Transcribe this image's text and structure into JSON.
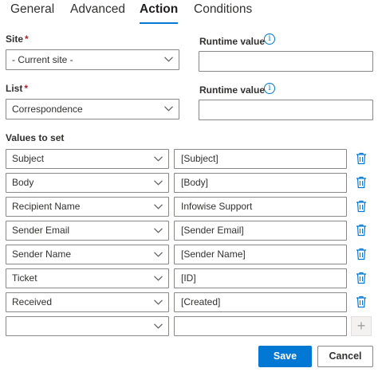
{
  "tabs": [
    {
      "label": "General"
    },
    {
      "label": "Advanced"
    },
    {
      "label": "Action"
    },
    {
      "label": "Conditions"
    }
  ],
  "active_tab": "Action",
  "site": {
    "label": "Site",
    "required_mark": "*",
    "value": "- Current site -"
  },
  "site_runtime": {
    "label": "Runtime value",
    "value": ""
  },
  "list": {
    "label": "List",
    "required_mark": "*",
    "value": "Correspondence"
  },
  "list_runtime": {
    "label": "Runtime value",
    "value": ""
  },
  "values_to_set": {
    "label": "Values to set",
    "rows": [
      {
        "field": "Subject",
        "value": "[Subject]"
      },
      {
        "field": "Body",
        "value": "[Body]"
      },
      {
        "field": "Recipient Name",
        "value": "Infowise Support"
      },
      {
        "field": "Sender Email",
        "value": "[Sender Email]"
      },
      {
        "field": "Sender Name",
        "value": "[Sender Name]"
      },
      {
        "field": "Ticket",
        "value": "[ID]"
      },
      {
        "field": "Received",
        "value": "[Created]"
      }
    ],
    "new_row": {
      "field": "",
      "value": ""
    },
    "add_symbol": "+"
  },
  "buttons": {
    "save": "Save",
    "cancel": "Cancel"
  },
  "icons": {
    "info": "info-icon",
    "chevron": "chevron-down-icon",
    "delete": "trash-icon",
    "add": "plus-icon"
  },
  "colors": {
    "accent": "#0078d4",
    "required": "#a4262c",
    "border": "#8a8886"
  }
}
